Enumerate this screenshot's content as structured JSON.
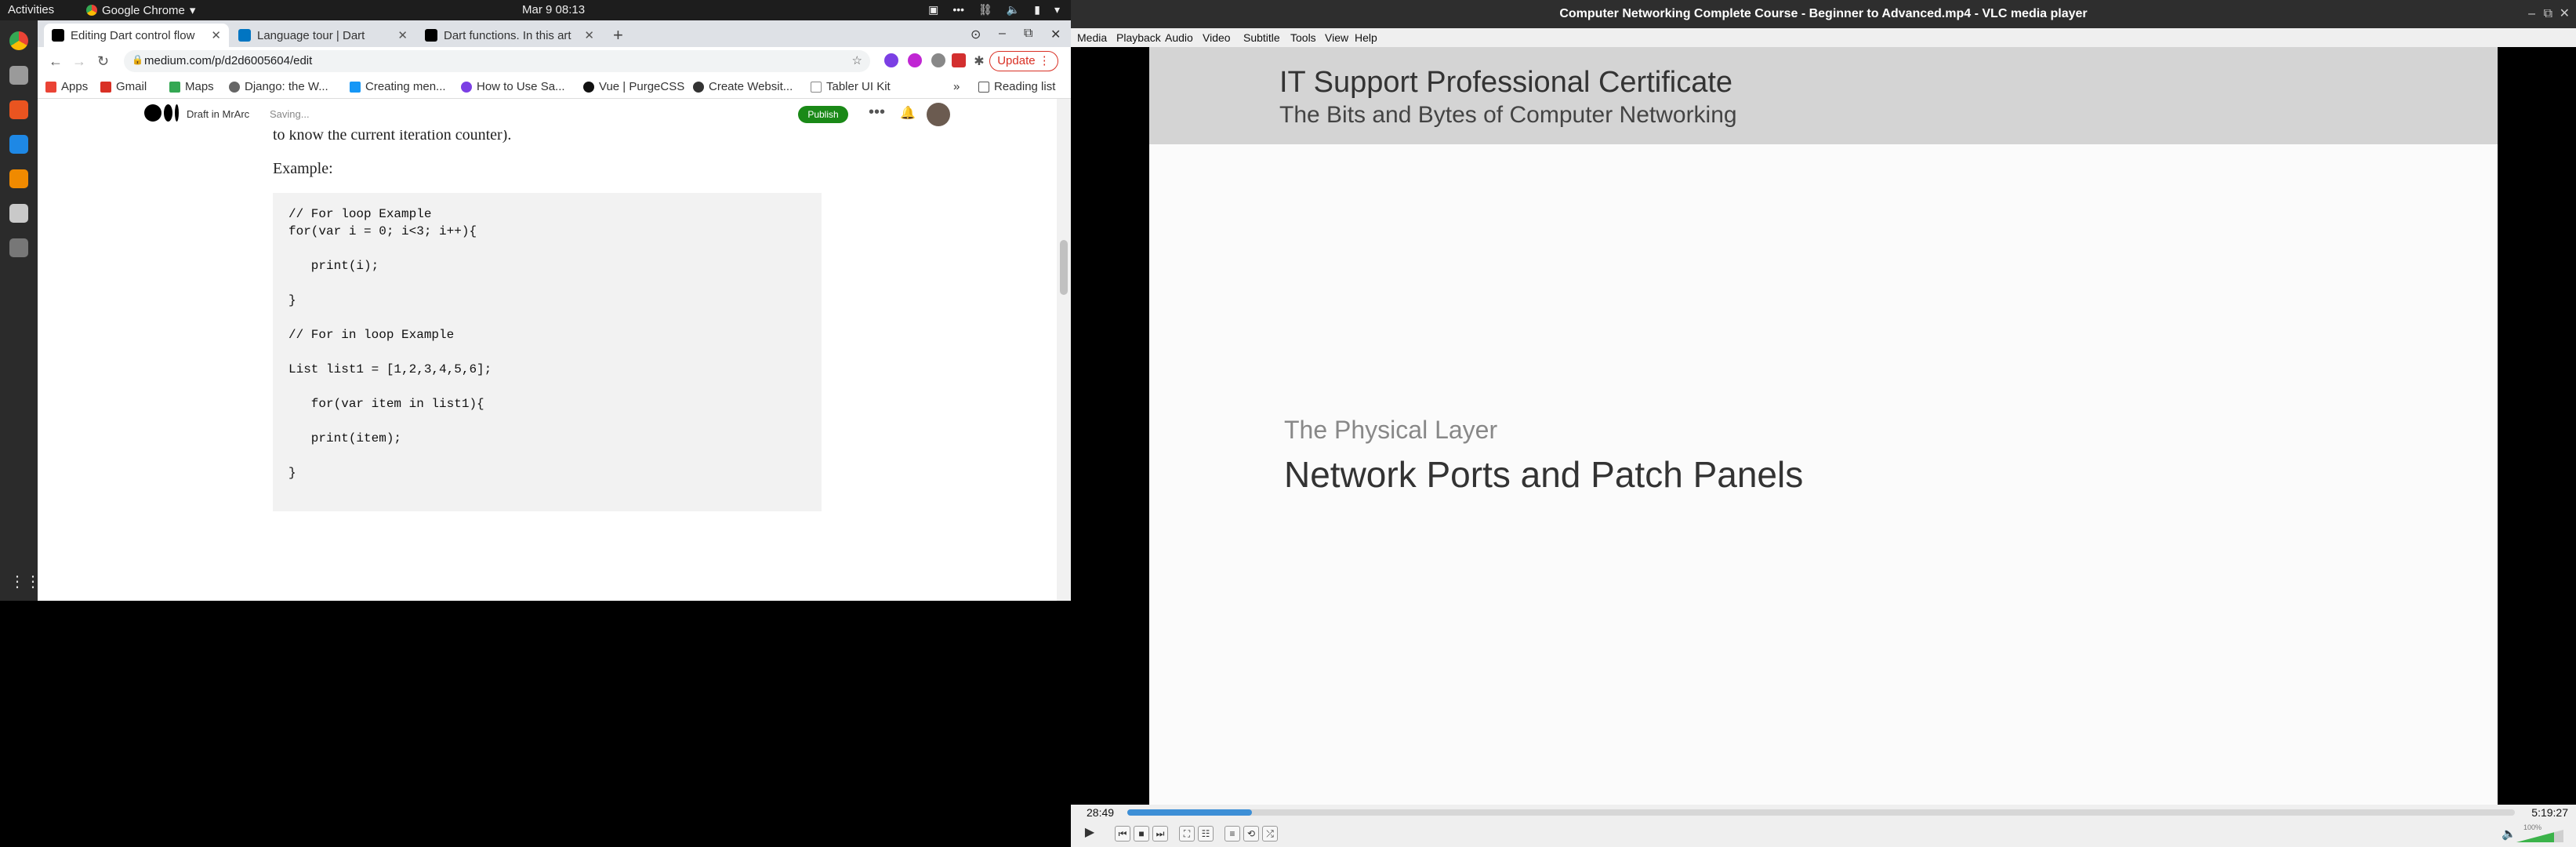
{
  "gnome": {
    "activities": "Activities",
    "app_name": "Google Chrome",
    "clock": "Mar 9  08:13"
  },
  "chrome": {
    "tabs": [
      {
        "title": "Editing Dart control flow",
        "active": true
      },
      {
        "title": "Language tour | Dart",
        "active": false
      },
      {
        "title": "Dart functions. In this art",
        "active": false
      }
    ],
    "url": "medium.com/p/d2d6005604/edit",
    "update_label": "Update",
    "bookmarks": [
      "Apps",
      "Gmail",
      "Maps",
      "Django: the W...",
      "Creating men...",
      "How to Use Sa...",
      "Vue | PurgeCSS",
      "Create Websit...",
      "Tabler UI Kit"
    ],
    "bookmarks_overflow": "»",
    "reading_list": "Reading list"
  },
  "medium": {
    "draft_label": "Draft in MrArc",
    "saving_label": "Saving...",
    "publish_label": "Publish",
    "partial_text": "to know the current iteration counter).",
    "example_label": "Example:",
    "code_lines": [
      "// For loop Example",
      "for(var i = 0; i<3; i++){",
      "",
      "   print(i);",
      "",
      "}",
      "",
      "// For in loop Example",
      "",
      "List list1 = [1,2,3,4,5,6];",
      "",
      "   for(var item in list1){",
      "",
      "   print(item);",
      "",
      "}"
    ]
  },
  "vlc": {
    "window_title": "Computer Networking Complete Course - Beginner to Advanced.mp4 - VLC media player",
    "menu": [
      "Media",
      "Playback",
      "Audio",
      "Video",
      "Subtitle",
      "Tools",
      "View",
      "Help"
    ],
    "slide": {
      "header_line1": "IT Support Professional Certificate",
      "header_line2": "The Bits and Bytes of Computer Networking",
      "subtitle": "The Physical Layer",
      "title": "Network Ports and Patch Panels"
    },
    "time_current": "28:49",
    "time_total": "5:19:27",
    "progress": 0.09,
    "volume_label": "100%"
  }
}
